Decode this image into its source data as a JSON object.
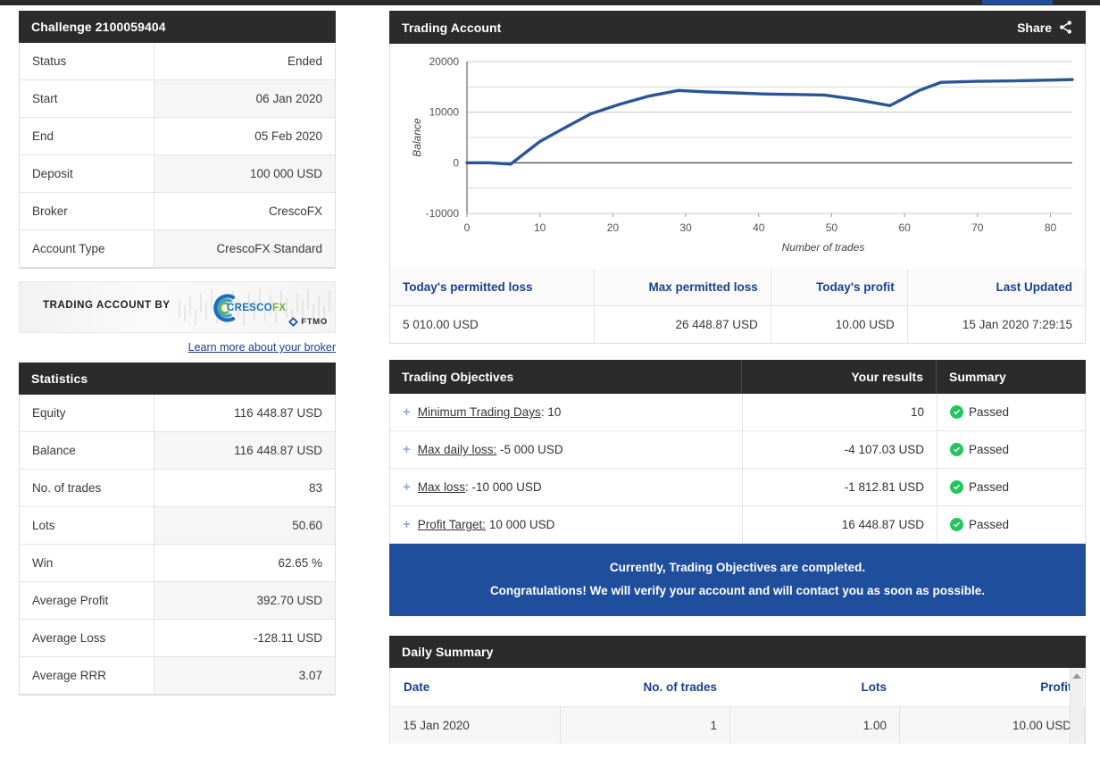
{
  "challenge": {
    "title": "Challenge 2100059404",
    "rows": [
      {
        "label": "Status",
        "value": "Ended"
      },
      {
        "label": "Start",
        "value": "06 Jan 2020"
      },
      {
        "label": "End",
        "value": "05 Feb 2020"
      },
      {
        "label": "Deposit",
        "value": "100 000 USD"
      },
      {
        "label": "Broker",
        "value": "CrescoFX"
      },
      {
        "label": "Account Type",
        "value": "CrescoFX Standard"
      }
    ]
  },
  "broker_banner": {
    "text": "TRADING ACCOUNT BY",
    "logo_primary": "CRESCO",
    "logo_secondary": "FX",
    "ftmo_label": "FTMO",
    "link": "Learn more about your broker"
  },
  "statistics": {
    "title": "Statistics",
    "rows": [
      {
        "label": "Equity",
        "value": "116 448.87 USD"
      },
      {
        "label": "Balance",
        "value": "116 448.87 USD"
      },
      {
        "label": "No. of trades",
        "value": "83"
      },
      {
        "label": "Lots",
        "value": "50.60"
      },
      {
        "label": "Win",
        "value": "62.65 %"
      },
      {
        "label": "Average Profit",
        "value": "392.70 USD"
      },
      {
        "label": "Average Loss",
        "value": "-128.11 USD"
      },
      {
        "label": "Average RRR",
        "value": "3.07"
      }
    ]
  },
  "trading_account": {
    "title": "Trading Account",
    "share_label": "Share"
  },
  "chart_data": {
    "type": "line",
    "title": "",
    "xlabel": "Number of trades",
    "ylabel": "Balance",
    "xlim": [
      0,
      83
    ],
    "ylim": [
      -10000,
      20000
    ],
    "xticks": [
      0,
      10,
      20,
      30,
      40,
      50,
      60,
      70,
      80
    ],
    "yticks": [
      -10000,
      0,
      10000,
      20000
    ],
    "grid": true,
    "legend": "none",
    "line_color": "#2a5699",
    "series": [
      {
        "name": "Balance",
        "x": [
          0,
          3,
          6,
          10,
          13,
          17,
          21,
          25,
          29,
          33,
          37,
          41,
          45,
          49,
          53,
          58,
          62,
          65,
          70,
          75,
          80,
          83
        ],
        "values": [
          0,
          0,
          -250,
          4200,
          6600,
          9700,
          11600,
          13200,
          14300,
          14000,
          13800,
          13600,
          13500,
          13400,
          12600,
          11300,
          14300,
          15900,
          16100,
          16200,
          16350,
          16449
        ]
      }
    ]
  },
  "permitted": {
    "headers": [
      "Today's permitted loss",
      "Max permitted loss",
      "Today's profit",
      "Last Updated"
    ],
    "values": [
      "5 010.00 USD",
      "26 448.87 USD",
      "10.00 USD",
      "15 Jan 2020 7:29:15"
    ]
  },
  "objectives": {
    "headers": [
      "Trading Objectives",
      "Your results",
      "Summary"
    ],
    "rows": [
      {
        "label": "Minimum Trading Days",
        "suffix": ": 10",
        "result": "10",
        "status": "Passed"
      },
      {
        "label": "Max daily loss:",
        "suffix": " -5 000 USD",
        "result": "-4 107.03 USD",
        "status": "Passed"
      },
      {
        "label": "Max loss",
        "suffix": ": -10 000 USD",
        "result": "-1 812.81 USD",
        "status": "Passed"
      },
      {
        "label": "Profit Target:",
        "suffix": " 10 000 USD",
        "result": "16 448.87 USD",
        "status": "Passed"
      }
    ],
    "banner_line1": "Currently, Trading Objectives are completed.",
    "banner_line2": "Congratulations! We will verify your account and will contact you as soon as possible."
  },
  "daily_summary": {
    "title": "Daily Summary",
    "headers": [
      "Date",
      "No. of trades",
      "Lots",
      "Profit"
    ],
    "rows": [
      {
        "date": "15 Jan 2020",
        "trades": "1",
        "lots": "1.00",
        "profit": "10.00 USD"
      }
    ]
  },
  "colors": {
    "header_dark": "#2b2b2b",
    "accent_blue": "#1a3f8f",
    "banner_blue": "#1f4e9c",
    "pass_green": "#22c55e",
    "chart_line": "#2a5699"
  }
}
